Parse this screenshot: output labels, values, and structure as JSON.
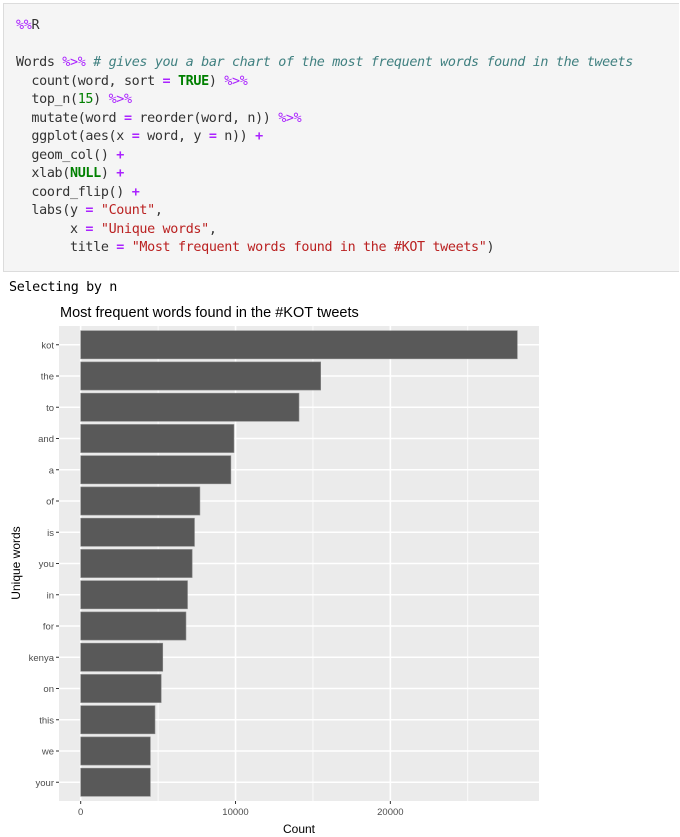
{
  "cell": {
    "magic": "%%R",
    "lines": [
      {
        "parts": [
          [
            "plain",
            "Words "
          ],
          [
            "pipe",
            "%>%"
          ],
          [
            "plain",
            " "
          ],
          [
            "cmt",
            "# gives you a bar chart of the most frequent words found in the tweets"
          ]
        ]
      },
      {
        "parts": [
          [
            "plain",
            "  count(word, sort "
          ],
          [
            "op",
            "="
          ],
          [
            "plain",
            " "
          ],
          [
            "kw",
            "TRUE"
          ],
          [
            "plain",
            ") "
          ],
          [
            "pipe",
            "%>%"
          ]
        ]
      },
      {
        "parts": [
          [
            "plain",
            "  top_n("
          ],
          [
            "num",
            "15"
          ],
          [
            "plain",
            ") "
          ],
          [
            "pipe",
            "%>%"
          ]
        ]
      },
      {
        "parts": [
          [
            "plain",
            "  mutate(word "
          ],
          [
            "op",
            "="
          ],
          [
            "plain",
            " reorder(word, n)) "
          ],
          [
            "pipe",
            "%>%"
          ]
        ]
      },
      {
        "parts": [
          [
            "plain",
            "  ggplot(aes(x "
          ],
          [
            "op",
            "="
          ],
          [
            "plain",
            " word, y "
          ],
          [
            "op",
            "="
          ],
          [
            "plain",
            " n)) "
          ],
          [
            "op",
            "+"
          ]
        ]
      },
      {
        "parts": [
          [
            "plain",
            "  geom_col() "
          ],
          [
            "op",
            "+"
          ]
        ]
      },
      {
        "parts": [
          [
            "plain",
            "  xlab("
          ],
          [
            "kw",
            "NULL"
          ],
          [
            "plain",
            ") "
          ],
          [
            "op",
            "+"
          ]
        ]
      },
      {
        "parts": [
          [
            "plain",
            "  coord_flip() "
          ],
          [
            "op",
            "+"
          ]
        ]
      },
      {
        "parts": [
          [
            "plain",
            "  labs(y "
          ],
          [
            "op",
            "="
          ],
          [
            "plain",
            " "
          ],
          [
            "str",
            "\"Count\""
          ],
          [
            "plain",
            ","
          ]
        ]
      },
      {
        "parts": [
          [
            "plain",
            "       x "
          ],
          [
            "op",
            "="
          ],
          [
            "plain",
            " "
          ],
          [
            "str",
            "\"Unique words\""
          ],
          [
            "plain",
            ","
          ]
        ]
      },
      {
        "parts": [
          [
            "plain",
            "       title "
          ],
          [
            "op",
            "="
          ],
          [
            "plain",
            " "
          ],
          [
            "str",
            "\"Most frequent words found in the #KOT tweets\""
          ],
          [
            "plain",
            ")"
          ]
        ]
      }
    ]
  },
  "output": {
    "message": "Selecting by n"
  },
  "colors": {
    "panel_bg": "#ebebeb",
    "grid": "#ffffff",
    "bar_fill": "#595959",
    "axis_text": "#4d4d4d",
    "title_text": "#000000"
  },
  "chart_data": {
    "type": "bar",
    "orientation": "horizontal",
    "title": "Most frequent words found in the #KOT tweets",
    "xlabel": "Unique words",
    "ylabel": "Count",
    "categories": [
      "kot",
      "the",
      "to",
      "and",
      "a",
      "of",
      "is",
      "you",
      "in",
      "for",
      "kenya",
      "on",
      "this",
      "we",
      "your"
    ],
    "values": [
      28200,
      15500,
      14100,
      9900,
      9700,
      7700,
      7350,
      7200,
      6900,
      6800,
      5300,
      5200,
      4800,
      4500,
      4500
    ],
    "value_ticks": [
      0,
      10000,
      20000
    ],
    "value_tick_labels": [
      "0",
      "10000",
      "20000"
    ],
    "ylim": [
      -1400,
      29600
    ],
    "grid": true,
    "legend": "none"
  }
}
